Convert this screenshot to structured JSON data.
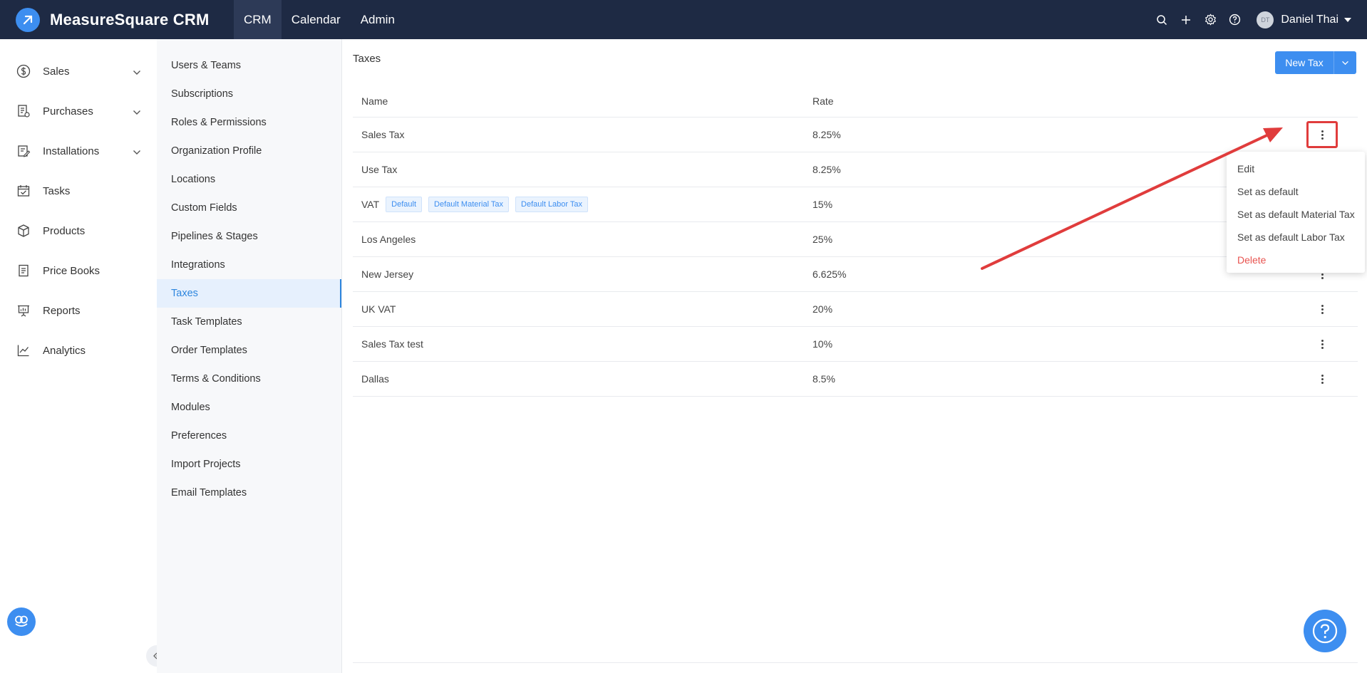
{
  "app": {
    "brand": "MeasureSquare CRM"
  },
  "topnav": {
    "items": [
      {
        "label": "CRM"
      },
      {
        "label": "Calendar"
      },
      {
        "label": "Admin"
      }
    ]
  },
  "user": {
    "initials": "DT",
    "name": "Daniel Thai"
  },
  "sidebar": {
    "items": [
      {
        "label": "Sales",
        "icon": "dollar-icon"
      },
      {
        "label": "Purchases",
        "icon": "receipt-icon"
      },
      {
        "label": "Installations",
        "icon": "clipboard-icon"
      },
      {
        "label": "Tasks",
        "icon": "calendar-check-icon"
      },
      {
        "label": "Products",
        "icon": "box-icon"
      },
      {
        "label": "Price Books",
        "icon": "book-icon"
      },
      {
        "label": "Reports",
        "icon": "presentation-icon"
      },
      {
        "label": "Analytics",
        "icon": "line-chart-icon"
      }
    ]
  },
  "submenu": {
    "items": [
      {
        "label": "Users & Teams"
      },
      {
        "label": "Subscriptions"
      },
      {
        "label": "Roles & Permissions"
      },
      {
        "label": "Organization Profile"
      },
      {
        "label": "Locations"
      },
      {
        "label": "Custom Fields"
      },
      {
        "label": "Pipelines & Stages"
      },
      {
        "label": "Integrations"
      },
      {
        "label": "Taxes"
      },
      {
        "label": "Task Templates"
      },
      {
        "label": "Order Templates"
      },
      {
        "label": "Terms & Conditions"
      },
      {
        "label": "Modules"
      },
      {
        "label": "Preferences"
      },
      {
        "label": "Import Projects"
      },
      {
        "label": "Email Templates"
      }
    ]
  },
  "main": {
    "title": "Taxes",
    "new_button": "New Tax",
    "columns": {
      "name": "Name",
      "rate": "Rate"
    },
    "rows": [
      {
        "name": "Sales Tax",
        "rate": "8.25%"
      },
      {
        "name": "Use Tax",
        "rate": "8.25%"
      },
      {
        "name": "VAT",
        "rate": "15%",
        "tags": [
          "Default",
          "Default Material Tax",
          "Default Labor Tax"
        ]
      },
      {
        "name": "Los Angeles",
        "rate": "25%"
      },
      {
        "name": "New Jersey",
        "rate": "6.625%"
      },
      {
        "name": "UK VAT",
        "rate": "20%"
      },
      {
        "name": "Sales Tax test",
        "rate": "10%"
      },
      {
        "name": "Dallas",
        "rate": "8.5%"
      }
    ]
  },
  "dropdown": {
    "items": [
      {
        "label": "Edit"
      },
      {
        "label": "Set as default"
      },
      {
        "label": "Set as default Material Tax"
      },
      {
        "label": "Set as default Labor Tax"
      },
      {
        "label": "Delete"
      }
    ]
  },
  "colors": {
    "topbar": "#1e2a44",
    "accent": "#3d8ef0",
    "danger": "#e8534f",
    "annotation": "#e03c3c"
  }
}
